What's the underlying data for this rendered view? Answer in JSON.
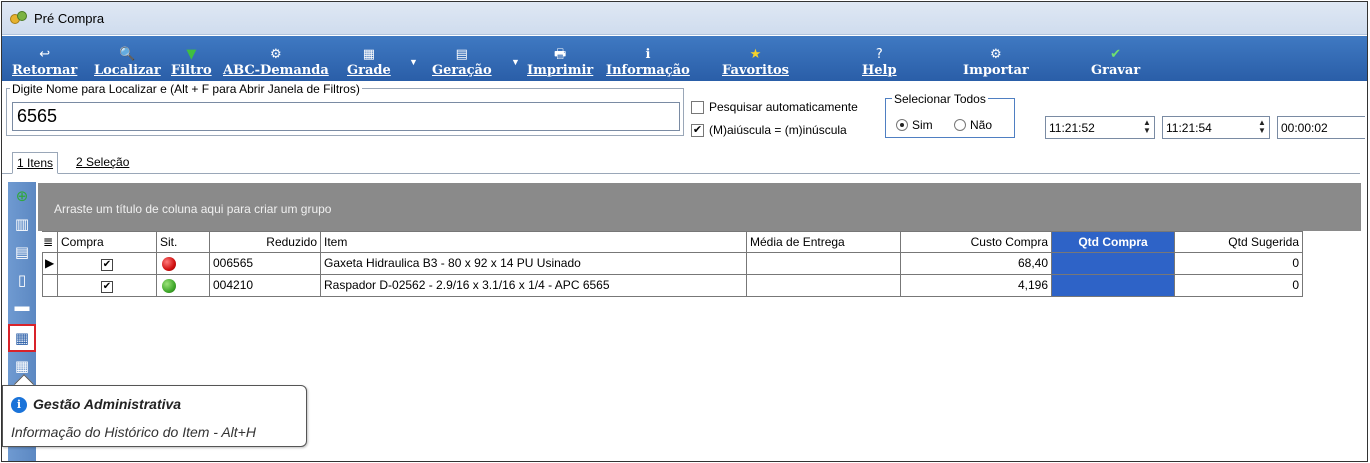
{
  "window": {
    "title": "Pré Compra"
  },
  "toolbar": [
    {
      "icon": "↩",
      "label": "Retornar"
    },
    {
      "icon": "🔍",
      "label": "Localizar"
    },
    {
      "icon": "▼",
      "label": "Filtro"
    },
    {
      "icon": "⚙",
      "label": "ABC-Demanda"
    },
    {
      "icon": "▦",
      "label": "Grade"
    },
    {
      "icon": "▤",
      "label": "Geração"
    },
    {
      "icon": "🖶",
      "label": "Imprimir"
    },
    {
      "icon": "ℹ",
      "label": "Informação"
    },
    {
      "icon": "★",
      "label": "Favoritos"
    },
    {
      "icon": "?",
      "label": "Help"
    },
    {
      "icon": "⚙",
      "label": "Importar"
    },
    {
      "icon": "✔",
      "label": "Gravar"
    }
  ],
  "search": {
    "legend": "Digite Nome para Localizar e (Alt + F para Abrir Janela de Filtros)",
    "value": "6565"
  },
  "options": {
    "auto_search": {
      "label": "Pesquisar automaticamente",
      "checked": false
    },
    "case": {
      "label": "(M)aiúscula = (m)inúscula",
      "checked": true
    }
  },
  "select_all": {
    "legend": "Selecionar Todos",
    "yes": "Sim",
    "no": "Não"
  },
  "times": [
    "11:21:52",
    "11:21:54",
    "00:00:02"
  ],
  "tabs": [
    "1 Itens",
    "2 Seleção"
  ],
  "group_hint": "Arraste um título de coluna aqui para criar um grupo",
  "grid": {
    "columns": [
      "Compra",
      "Sit.",
      "Reduzido",
      "Item",
      "Média de Entrega",
      "Custo Compra",
      "Qtd Compra",
      "Qtd Sugerida"
    ],
    "rows": [
      {
        "compra": "✔",
        "sit": "red",
        "reduzido": "006565",
        "item": "Gaxeta Hidraulica B3 - 80 x 92 x 14 PU Usinado",
        "media": "",
        "custo": "68,40",
        "qtd": "",
        "sugerida": "0"
      },
      {
        "compra": "✔",
        "sit": "green",
        "reduzido": "004210",
        "item": "Raspador D-02562 - 2.9/16 x 3.1/16 x 1/4 - APC 6565",
        "media": "",
        "custo": "4,196",
        "qtd": "",
        "sugerida": "0"
      }
    ]
  },
  "tooltip": {
    "title": "Gestão Administrativa",
    "text": "Informação do Histórico do Item - Alt+H"
  },
  "colors": {
    "toolbar": "#2f66b0",
    "highlight": "#2e63c7",
    "sidebar": "#6a95cc"
  }
}
